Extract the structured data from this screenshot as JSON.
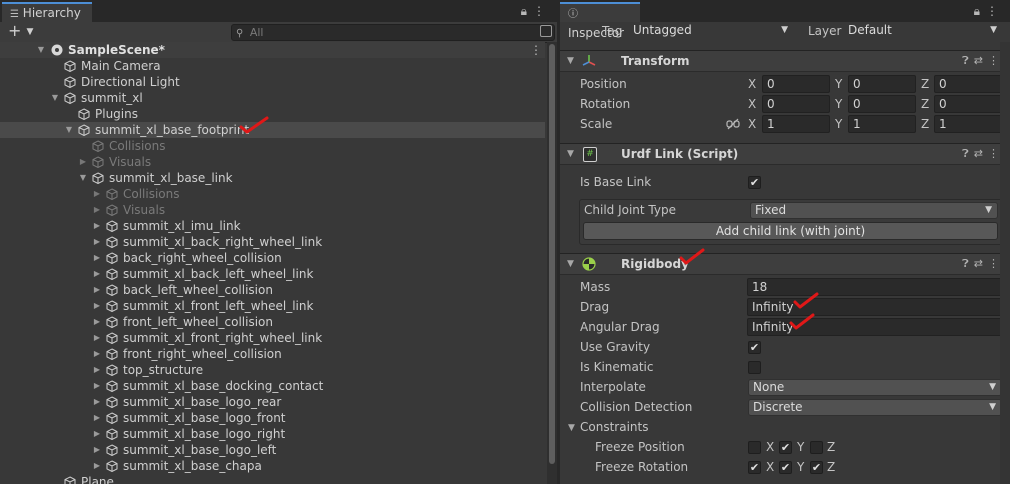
{
  "hierarchy": {
    "tab_label": "Hierarchy",
    "add_button": "+",
    "search_placeholder": "All",
    "items": [
      {
        "label": "SampleScene*"
      },
      {
        "label": "Main Camera"
      },
      {
        "label": "Directional Light"
      },
      {
        "label": "summit_xl"
      },
      {
        "label": "Plugins"
      },
      {
        "label": "summit_xl_base_footprint"
      },
      {
        "label": "Collisions"
      },
      {
        "label": "Visuals"
      },
      {
        "label": "summit_xl_base_link"
      },
      {
        "label": "Collisions"
      },
      {
        "label": "Visuals"
      },
      {
        "label": "summit_xl_imu_link"
      },
      {
        "label": "summit_xl_back_right_wheel_link"
      },
      {
        "label": "back_right_wheel_collision"
      },
      {
        "label": "summit_xl_back_left_wheel_link"
      },
      {
        "label": "back_left_wheel_collision"
      },
      {
        "label": "summit_xl_front_left_wheel_link"
      },
      {
        "label": "front_left_wheel_collision"
      },
      {
        "label": "summit_xl_front_right_wheel_link"
      },
      {
        "label": "front_right_wheel_collision"
      },
      {
        "label": "top_structure"
      },
      {
        "label": "summit_xl_base_docking_contact"
      },
      {
        "label": "summit_xl_base_logo_rear"
      },
      {
        "label": "summit_xl_base_logo_front"
      },
      {
        "label": "summit_xl_base_logo_right"
      },
      {
        "label": "summit_xl_base_logo_left"
      },
      {
        "label": "summit_xl_base_chapa"
      },
      {
        "label": "Plane"
      }
    ]
  },
  "inspector": {
    "tab_label": "Inspector",
    "tag_label": "Tag",
    "tag_value": "Untagged",
    "layer_label": "Layer",
    "layer_value": "Default",
    "transform": {
      "title": "Transform",
      "axis_x": "X",
      "axis_y": "Y",
      "axis_z": "Z",
      "position_label": "Position",
      "position": {
        "x": "0",
        "y": "0",
        "z": "0"
      },
      "rotation_label": "Rotation",
      "rotation": {
        "x": "0",
        "y": "0",
        "z": "0"
      },
      "scale_label": "Scale",
      "scale": {
        "x": "1",
        "y": "1",
        "z": "1"
      }
    },
    "urdf_link": {
      "title": "Urdf Link (Script)",
      "is_base_link_label": "Is Base Link",
      "child_joint_type_label": "Child Joint Type",
      "child_joint_type_value": "Fixed",
      "add_child_link_button": "Add child link (with joint)"
    },
    "rigidbody": {
      "title": "Rigidbody",
      "mass_label": "Mass",
      "mass_value": "18",
      "drag_label": "Drag",
      "drag_value": "Infinity",
      "angular_drag_label": "Angular Drag",
      "angular_drag_value": "Infinity",
      "use_gravity_label": "Use Gravity",
      "is_kinematic_label": "Is Kinematic",
      "interpolate_label": "Interpolate",
      "interpolate_value": "None",
      "collision_detection_label": "Collision Detection",
      "collision_detection_value": "Discrete",
      "constraints_label": "Constraints",
      "freeze_position_label": "Freeze Position",
      "freeze_rotation_label": "Freeze Rotation",
      "axis_x": "X",
      "axis_y": "Y",
      "axis_z": "Z"
    }
  },
  "colors": {
    "accent_tab": "#4d8fd6",
    "annotation": "#e01818"
  }
}
